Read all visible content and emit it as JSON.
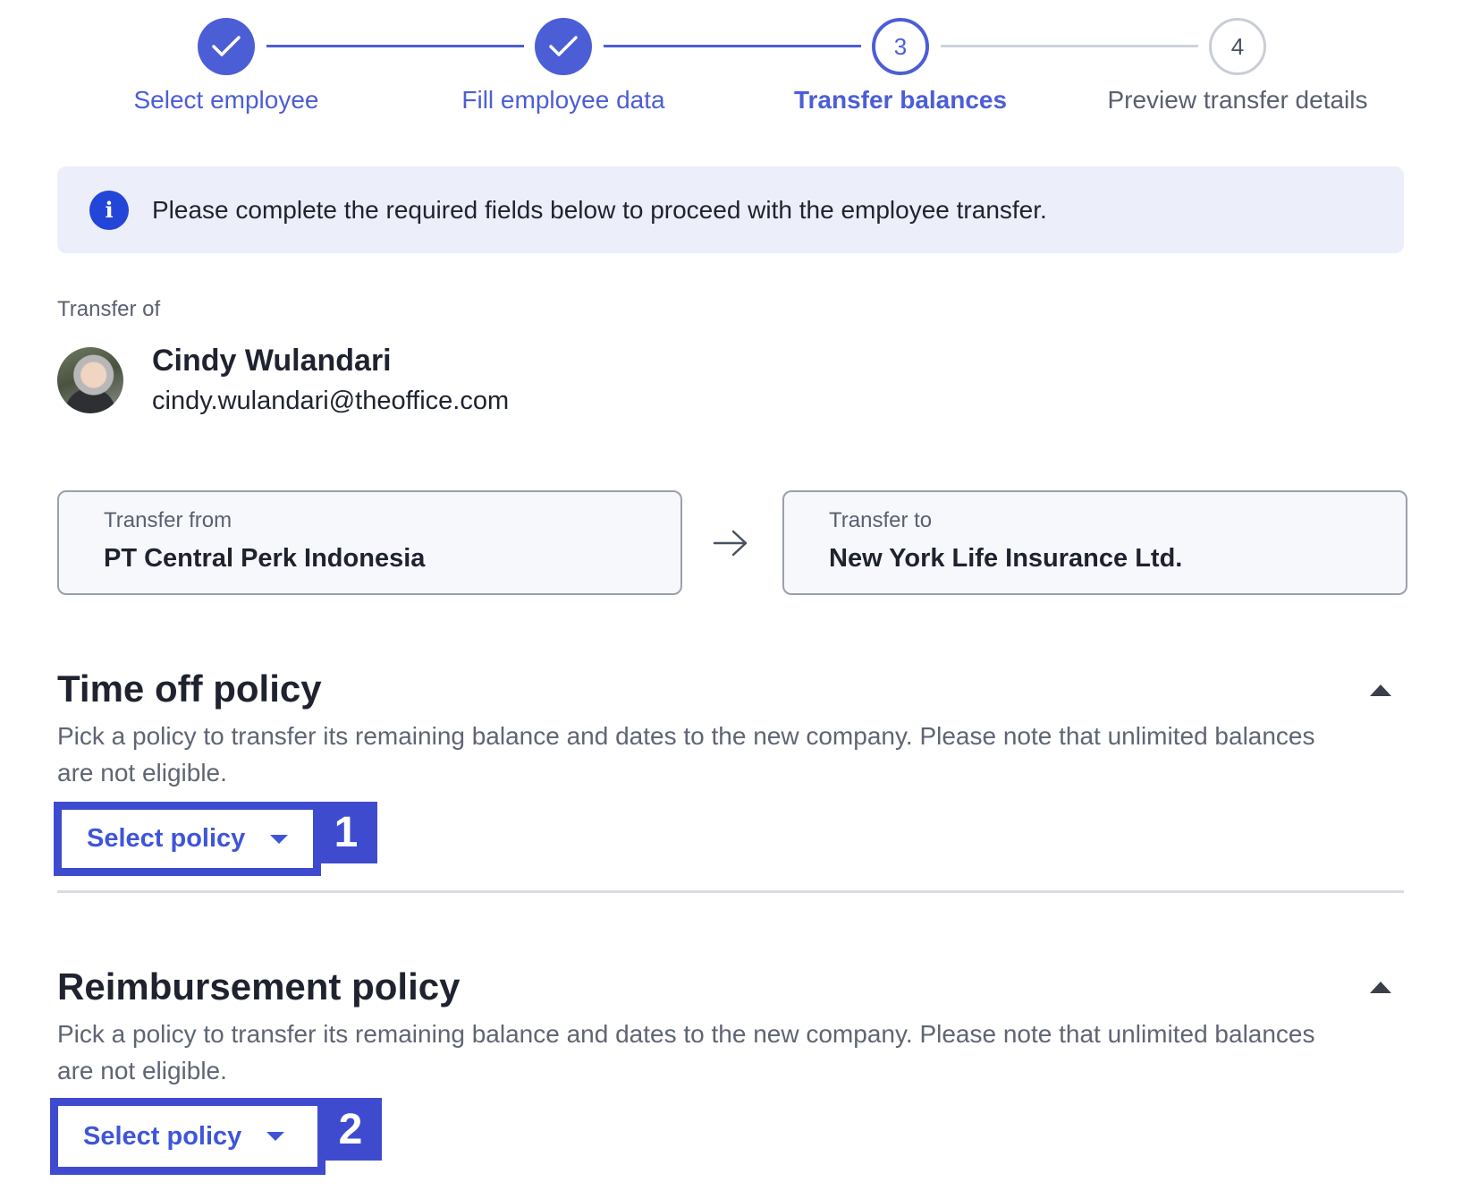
{
  "stepper": {
    "steps": [
      {
        "number": "1",
        "label": "Select employee",
        "state": "done"
      },
      {
        "number": "2",
        "label": "Fill employee data",
        "state": "done"
      },
      {
        "number": "3",
        "label": "Transfer balances",
        "state": "active"
      },
      {
        "number": "4",
        "label": "Preview transfer details",
        "state": "todo"
      }
    ]
  },
  "banner": {
    "icon": "info-icon",
    "text": "Please complete the required fields below to proceed with the employee transfer."
  },
  "employee": {
    "section_label": "Transfer of",
    "name": "Cindy Wulandari",
    "email": "cindy.wulandari@theoffice.com"
  },
  "transfer": {
    "from_label": "Transfer from",
    "from_value": "PT Central Perk Indonesia",
    "to_label": "Transfer to",
    "to_value": "New York Life Insurance Ltd."
  },
  "policies": [
    {
      "title": "Time off policy",
      "description": "Pick a policy to transfer its remaining balance and dates to the new company. Please note that unlimited balances are not eligible.",
      "select_label": "Select policy",
      "badge": "1"
    },
    {
      "title": "Reimbursement policy",
      "description": "Pick a policy to transfer its remaining balance and dates to the new company. Please note that unlimited balances are not eligible.",
      "select_label": "Select policy",
      "badge": "2"
    }
  ],
  "colors": {
    "accent": "#4c5ed6",
    "annotation": "#3f4bcf",
    "banner_bg": "#eceefa",
    "info_icon": "#2446d8"
  }
}
